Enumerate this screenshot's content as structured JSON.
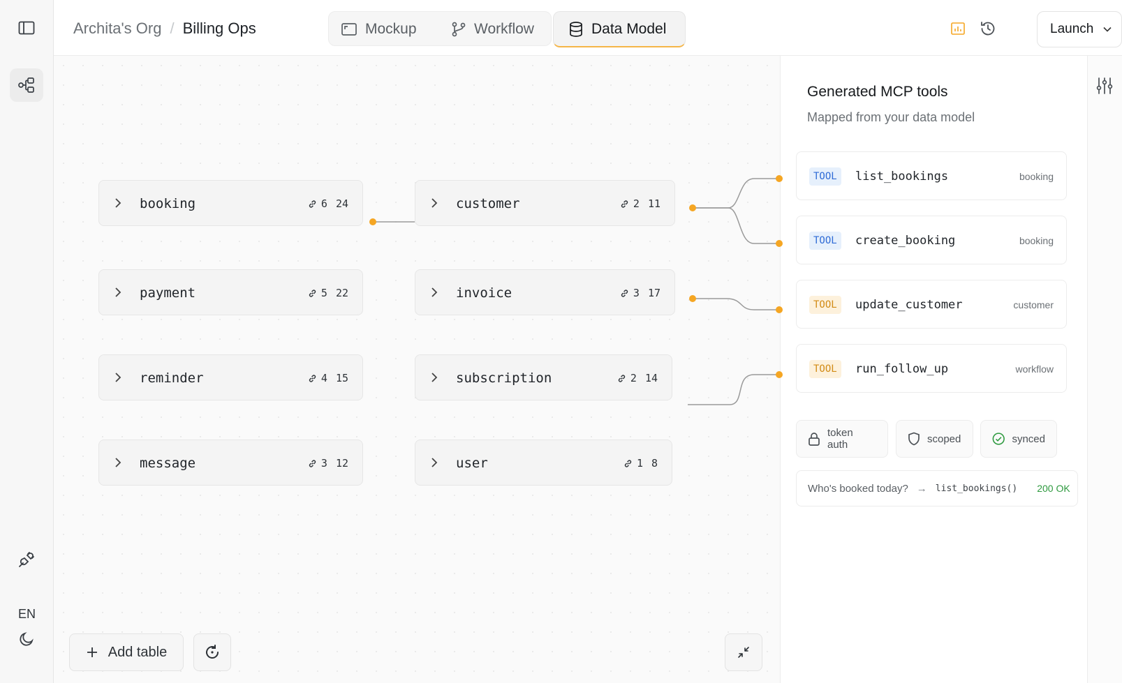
{
  "breadcrumb": {
    "org": "Archita's Org",
    "separator": "/",
    "project": "Billing Ops"
  },
  "tabs": [
    {
      "label": "Mockup",
      "icon": "mockup-icon"
    },
    {
      "label": "Workflow",
      "icon": "branch-icon"
    },
    {
      "label": "Data Model",
      "icon": "database-icon",
      "active": true
    }
  ],
  "topbar": {
    "launch_label": "Launch"
  },
  "rail": {
    "lang": "EN"
  },
  "tables": [
    {
      "name": "booking",
      "links": "6",
      "cols": "24"
    },
    {
      "name": "customer",
      "links": "2",
      "cols": "11"
    },
    {
      "name": "payment",
      "links": "5",
      "cols": "22"
    },
    {
      "name": "invoice",
      "links": "3",
      "cols": "17"
    },
    {
      "name": "reminder",
      "links": "4",
      "cols": "15"
    },
    {
      "name": "subscription",
      "links": "2",
      "cols": "14"
    },
    {
      "name": "message",
      "links": "3",
      "cols": "12"
    },
    {
      "name": "user",
      "links": "1",
      "cols": "8"
    }
  ],
  "canvas": {
    "add_table_label": "Add table"
  },
  "panel": {
    "title": "Generated MCP tools",
    "subtitle": "Mapped from your data model",
    "tools": [
      {
        "badge": "TOOL",
        "name": "list_bookings",
        "tag": "booking",
        "color": "#2f6bd6"
      },
      {
        "badge": "TOOL",
        "name": "create_booking",
        "tag": "booking",
        "color": "#2f6bd6"
      },
      {
        "badge": "TOOL",
        "name": "update_customer",
        "tag": "customer",
        "color": "#d28b15"
      },
      {
        "badge": "TOOL",
        "name": "run_follow_up",
        "tag": "workflow",
        "color": "#d28b15"
      }
    ],
    "chips": [
      {
        "label": "token auth",
        "icon": "lock-icon"
      },
      {
        "label": "scoped",
        "icon": "shield-icon"
      },
      {
        "label": "synced",
        "icon": "check-circle-icon"
      }
    ],
    "query": {
      "question": "Who's booked today?",
      "call": "list_bookings()",
      "status": "200 OK"
    }
  },
  "colors": {
    "accent": "#f5a623",
    "ok": "#2e9a3f"
  }
}
